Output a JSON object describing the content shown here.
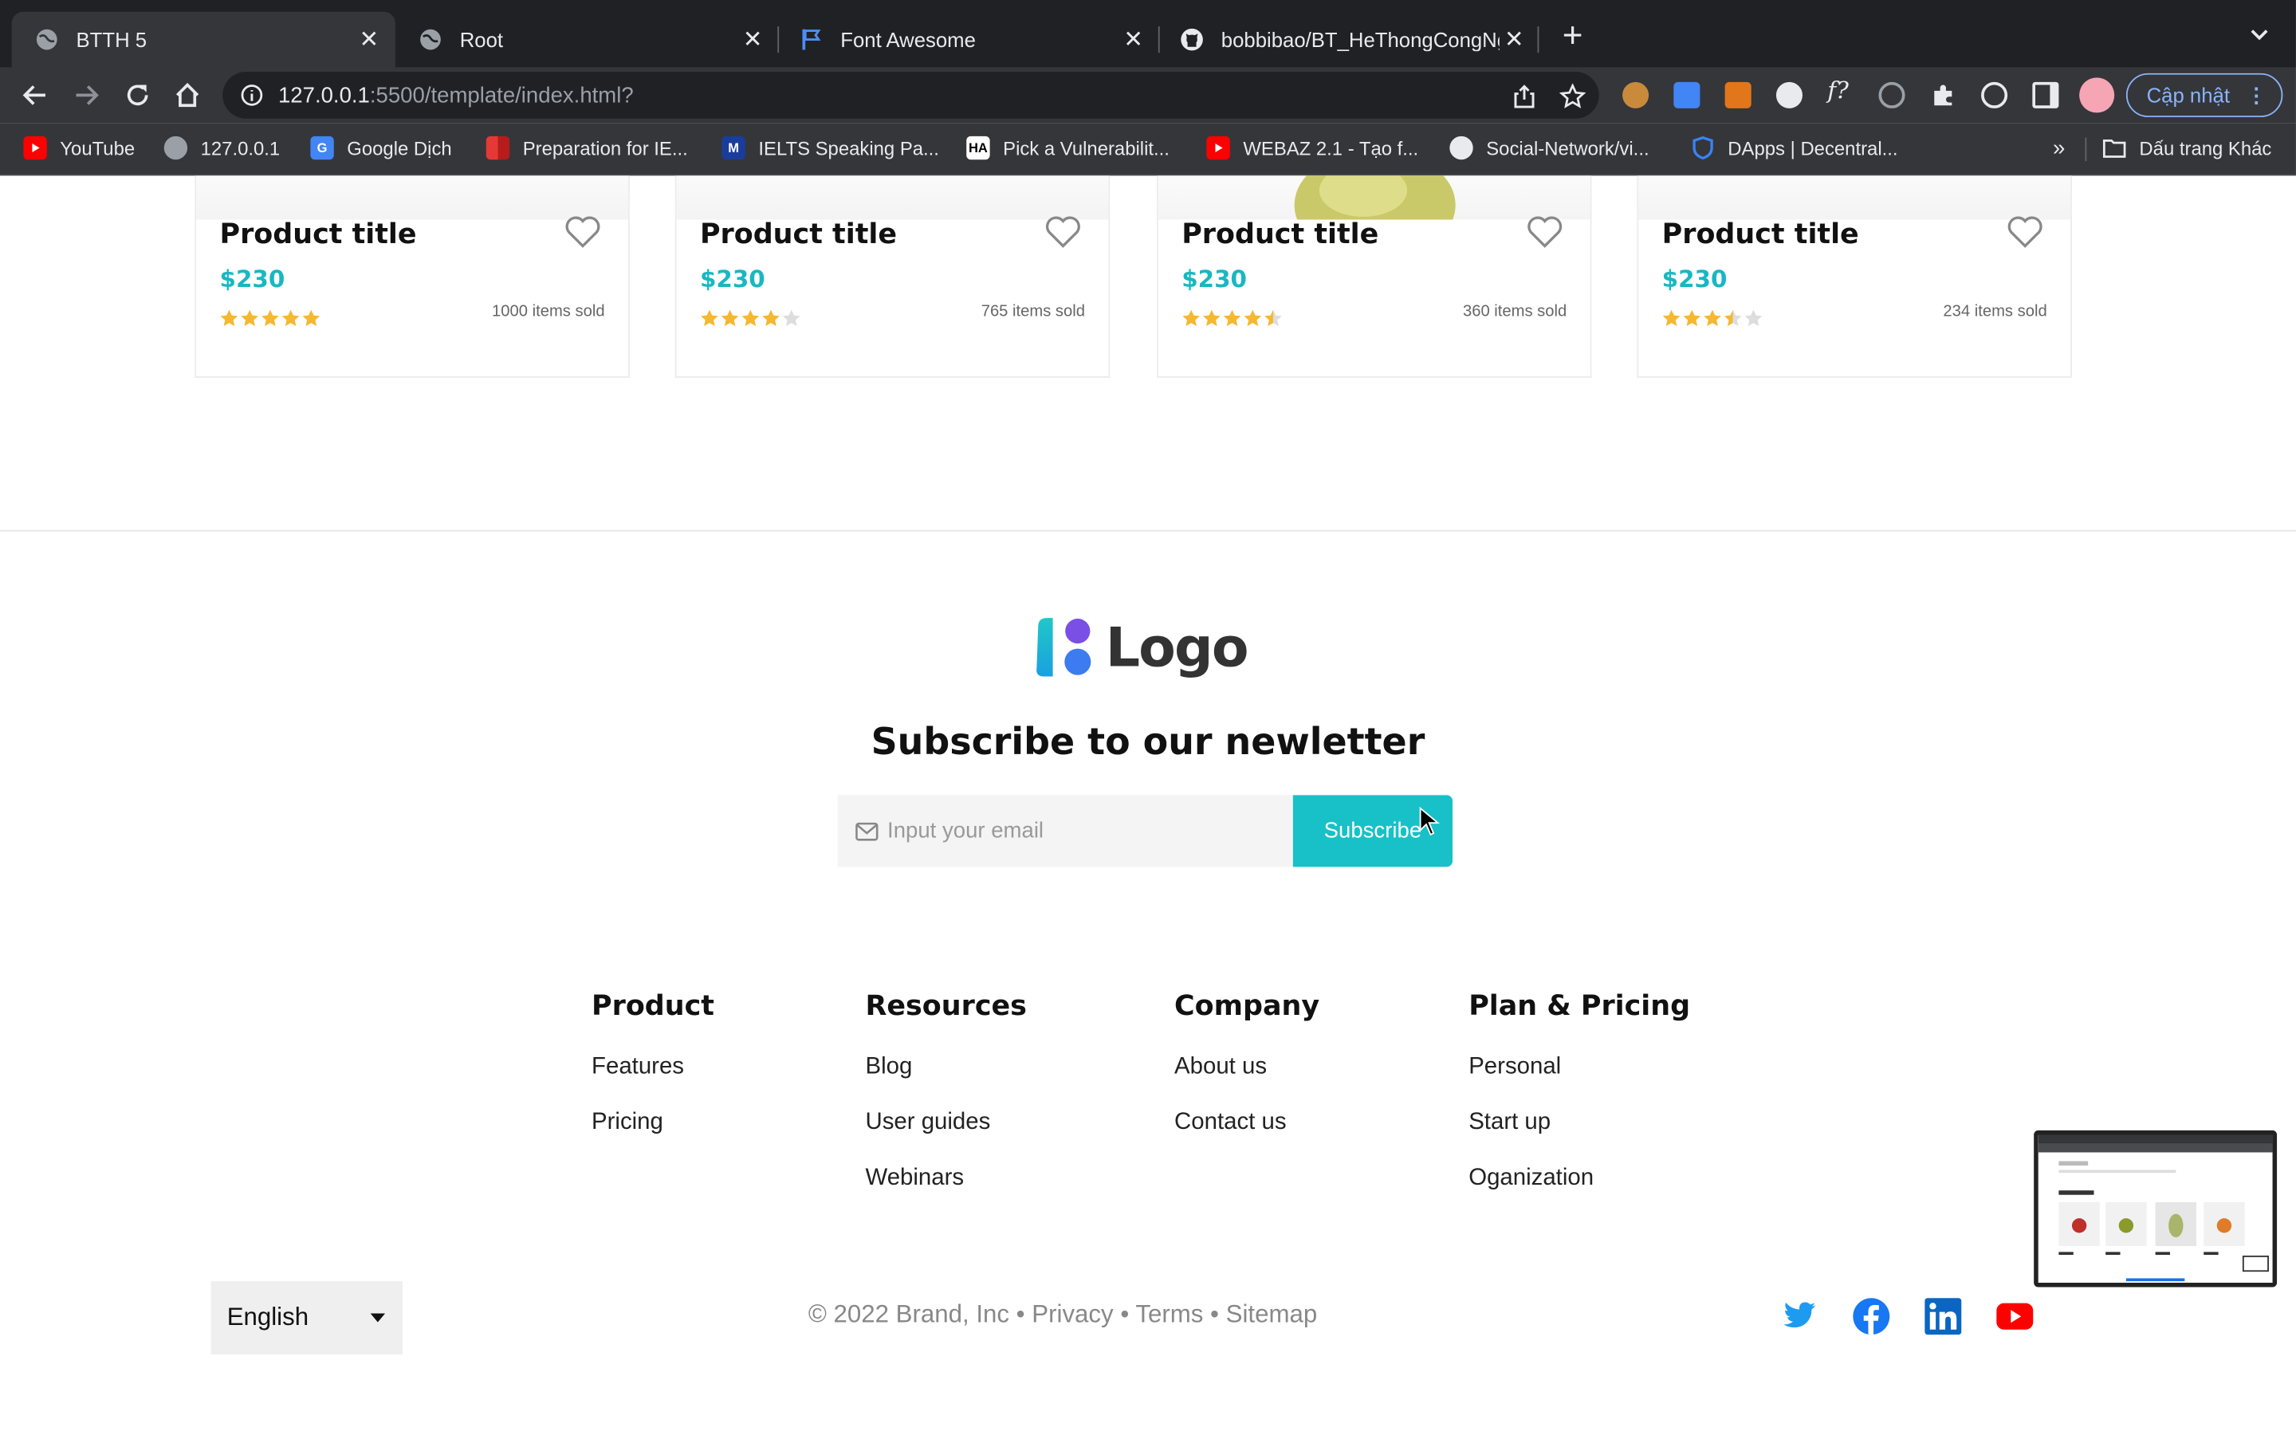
{
  "browser": {
    "tabs": [
      {
        "title": "BTTH 5",
        "active": true,
        "icon": "globe-icon"
      },
      {
        "title": "Root",
        "active": false,
        "icon": "globe-icon"
      },
      {
        "title": "Font Awesome",
        "active": false,
        "icon": "flag-icon"
      },
      {
        "title": "bobbibao/BT_HeThongCongNg",
        "active": false,
        "icon": "github-icon"
      }
    ],
    "url_host": "127.0.0.1",
    "url_rest": ":5500/template/index.html?",
    "update_label": "Cập nhật",
    "bookmarks": [
      {
        "label": "YouTube",
        "icon": "youtube-icon",
        "color": "#ff0000"
      },
      {
        "label": "127.0.0.1",
        "icon": "globe-icon",
        "color": "#9aa0a6"
      },
      {
        "label": "Google Dịch",
        "icon": "google-translate-icon",
        "color": "#4285f4"
      },
      {
        "label": "Preparation for IE...",
        "icon": "grid-logo-icon",
        "color": "#e53935"
      },
      {
        "label": "IELTS Speaking Pa...",
        "icon": "ielts-logo-icon",
        "color": "#1a3d9c"
      },
      {
        "label": "Pick a Vulnerabilit...",
        "icon": "ha-logo-icon",
        "color": "#ffffff"
      },
      {
        "label": "WEBAZ 2.1 - Tạo f...",
        "icon": "youtube-icon",
        "color": "#ff0000"
      },
      {
        "label": "Social-Network/vi...",
        "icon": "github-icon",
        "color": "#ffffff"
      },
      {
        "label": "DApps | Decentral...",
        "icon": "shield-icon",
        "color": "#3b82f6"
      }
    ],
    "bookmarks_more": "»",
    "other_bookmarks": "Dấu trang Khác"
  },
  "products": [
    {
      "title": "Product title",
      "price": "$230",
      "rating": 5,
      "sold": "1000 items sold"
    },
    {
      "title": "Product title",
      "price": "$230",
      "rating": 4,
      "sold": "765 items sold"
    },
    {
      "title": "Product title",
      "price": "$230",
      "rating": 4.5,
      "sold": "360 items sold"
    },
    {
      "title": "Product title",
      "price": "$230",
      "rating": 3.5,
      "sold": "234 items sold"
    }
  ],
  "footer": {
    "logo_text": "Logo",
    "subscribe_title": "Subscribe to our newletter",
    "email_placeholder": "Input your email",
    "subscribe_button": "Subscribe",
    "columns": [
      {
        "heading": "Product",
        "links": [
          "Features",
          "Pricing"
        ]
      },
      {
        "heading": "Resources",
        "links": [
          "Blog",
          "User guides",
          "Webinars"
        ]
      },
      {
        "heading": "Company",
        "links": [
          "About us",
          "Contact us"
        ]
      },
      {
        "heading": "Plan & Pricing",
        "links": [
          "Personal",
          "Start up",
          "Oganization"
        ]
      }
    ],
    "language": "English",
    "copyright": "© 2022 Brand, Inc • Privacy • Terms • Sitemap",
    "social": [
      "twitter-icon",
      "facebook-icon",
      "linkedin-icon",
      "youtube-icon"
    ]
  },
  "colors": {
    "accent": "#17c1c7",
    "price": "#17b8c2",
    "star": "#f5b82e",
    "star_empty": "#dddddd"
  }
}
